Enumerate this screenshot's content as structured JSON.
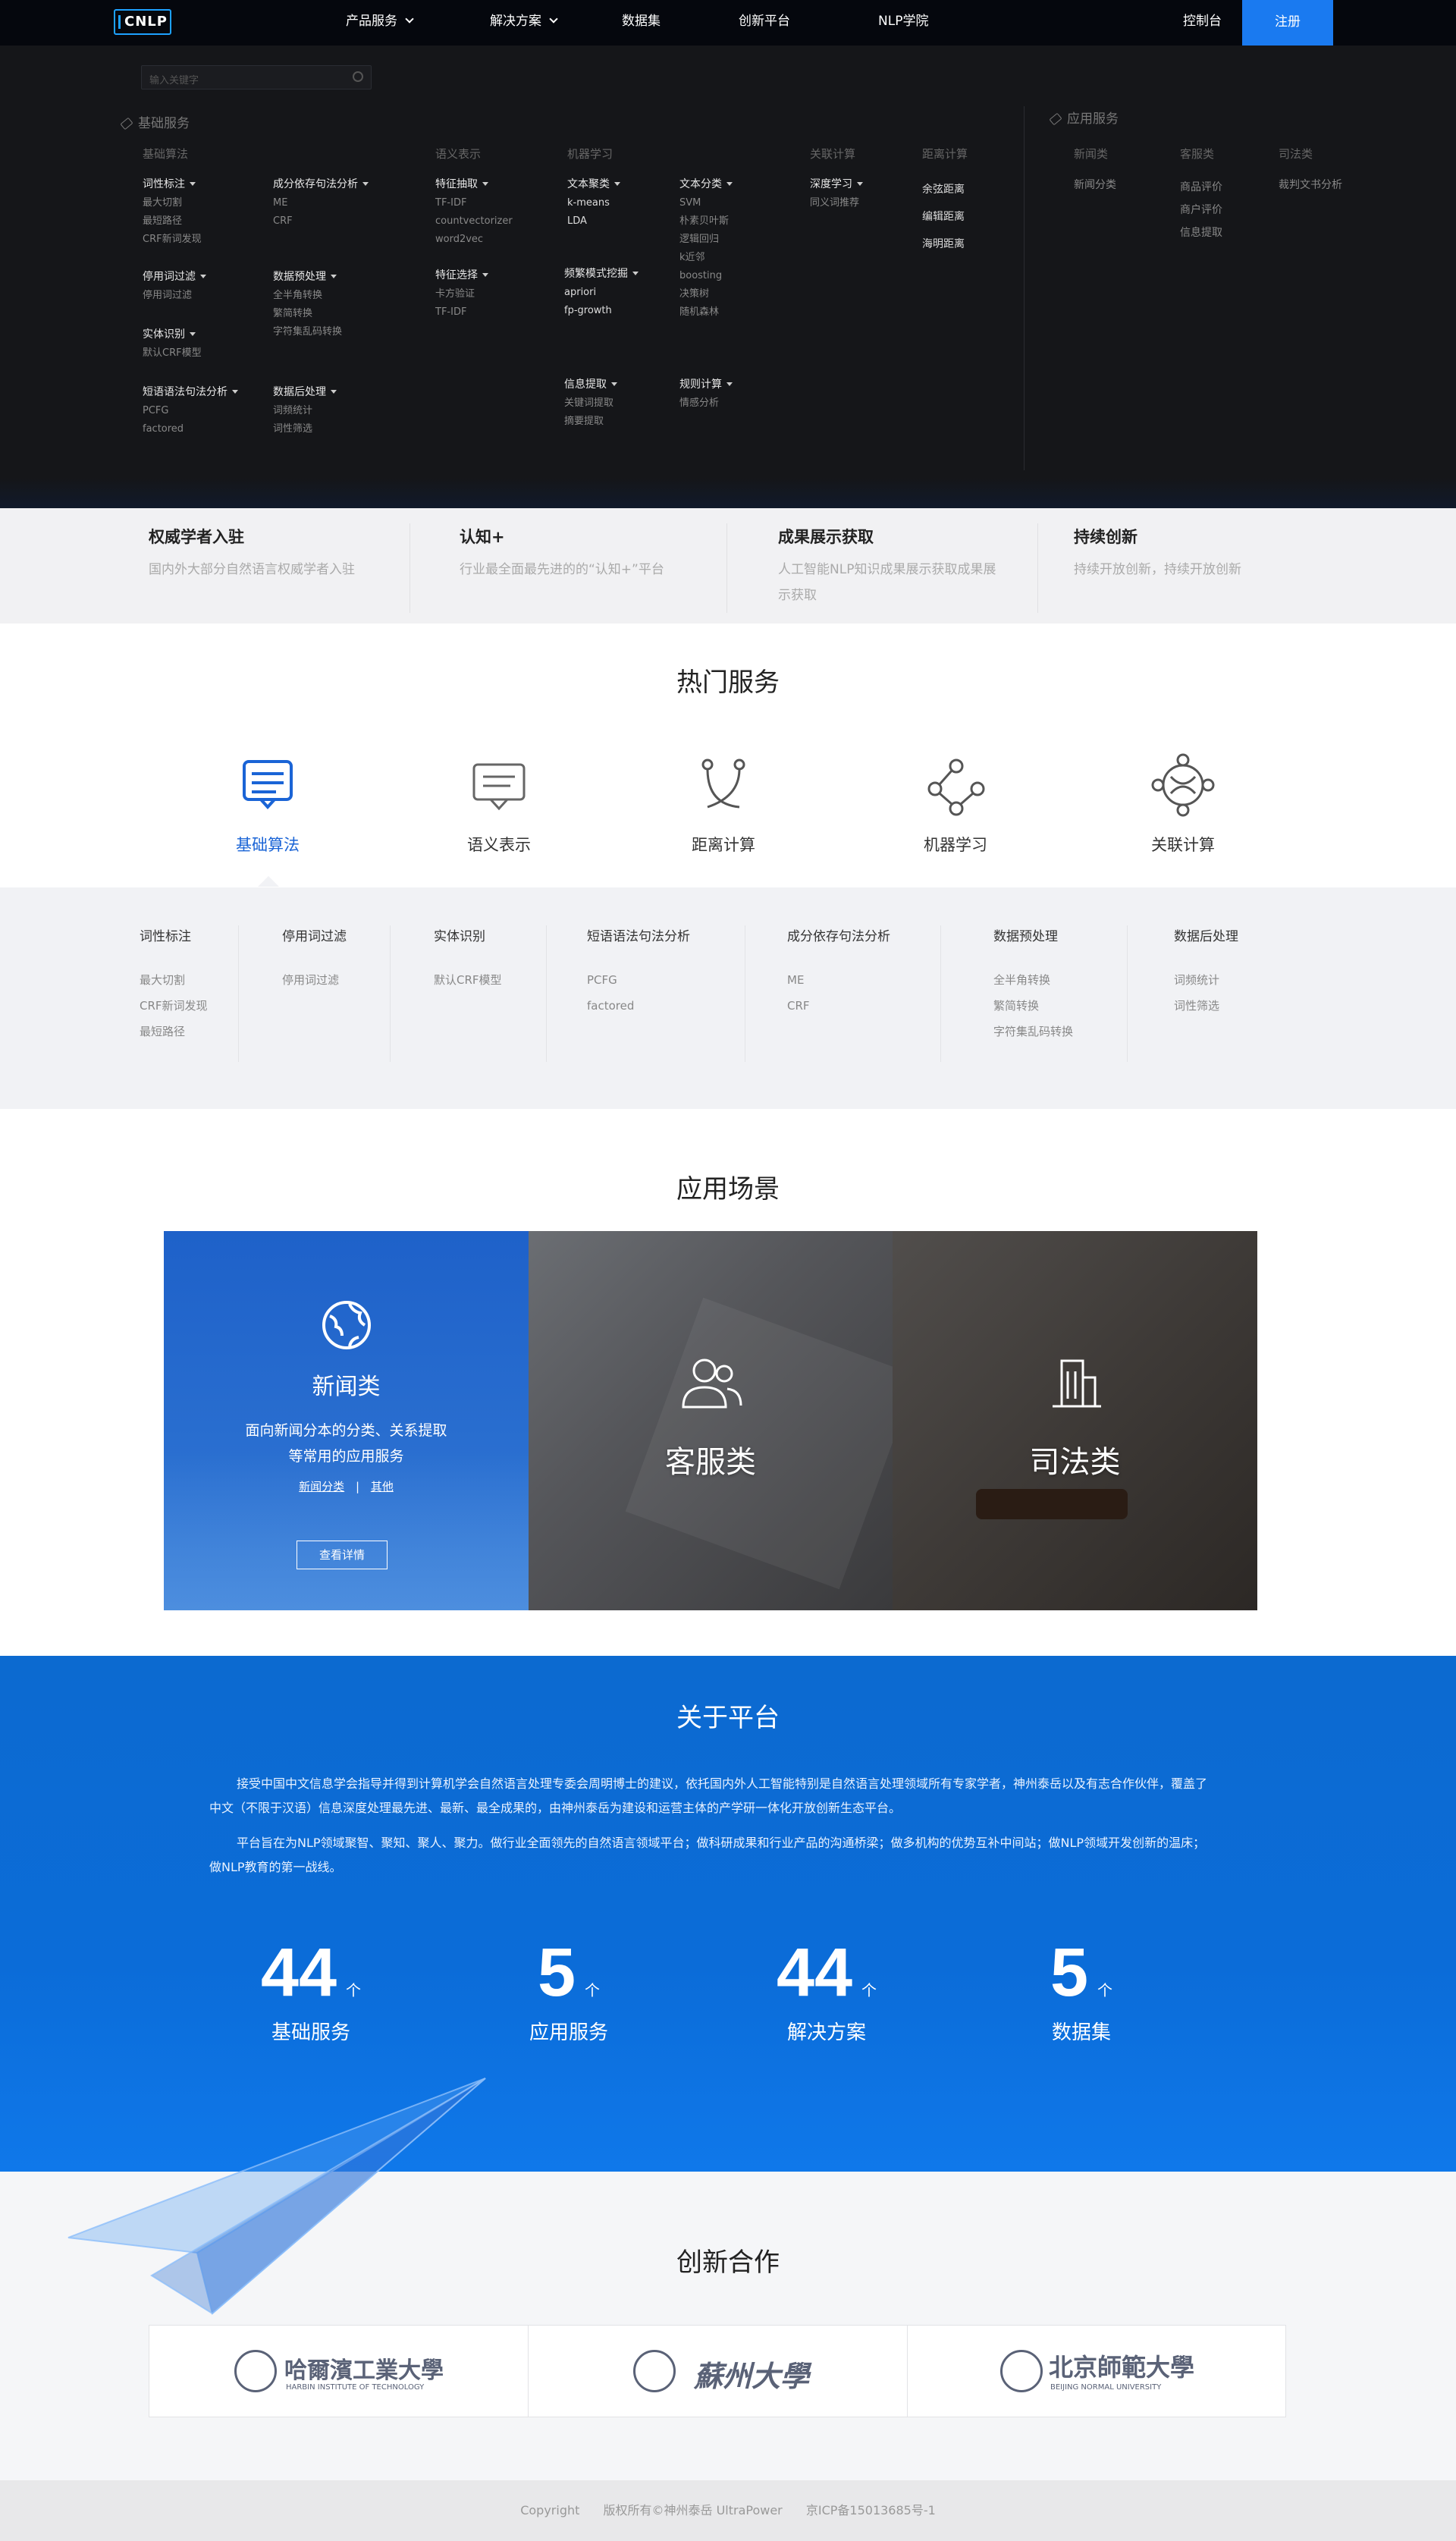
{
  "nav": {
    "logo": "CNLP",
    "items": [
      "产品服务",
      "解决方案",
      "数据集",
      "创新平台",
      "NLP学院"
    ],
    "console": "控制台",
    "register": "注册"
  },
  "mega": {
    "search_placeholder": "输入关键字",
    "basic_header": "基础服务",
    "app_header": "应用服务",
    "cats": {
      "basic_algo": "基础算法",
      "semantic": "语义表示",
      "ml": "机器学习",
      "assoc": "关联计算",
      "dist": "距离计算",
      "news": "新闻类",
      "cs": "客服类",
      "law": "司法类"
    },
    "groups": {
      "pos": {
        "title": "词性标注",
        "items": [
          "最大切割",
          "最短路径",
          "CRF新词发现"
        ]
      },
      "const": {
        "title": "成分依存句法分析",
        "items": [
          "ME",
          "CRF"
        ]
      },
      "stop": {
        "title": "停用词过滤",
        "items": [
          "停用词过滤"
        ]
      },
      "pre": {
        "title": "数据预处理",
        "items": [
          "全半角转换",
          "繁简转换",
          "字符集乱码转换"
        ]
      },
      "ner": {
        "title": "实体识别",
        "items": [
          "默认CRF模型"
        ]
      },
      "phrase": {
        "title": "短语语法句法分析",
        "items": [
          "PCFG",
          "factored"
        ]
      },
      "post": {
        "title": "数据后处理",
        "items": [
          "词频统计",
          "词性筛选"
        ]
      },
      "feat": {
        "title": "特征抽取",
        "items": [
          "TF-IDF",
          "countvectorizer",
          "word2vec"
        ]
      },
      "fsel": {
        "title": "特征选择",
        "items": [
          "卡方验证",
          "TF-IDF"
        ]
      },
      "tclu": {
        "title": "文本聚类",
        "items": [
          "k-means",
          "LDA"
        ]
      },
      "freq": {
        "title": "频繁模式挖掘",
        "items": [
          "apriori",
          "fp-growth"
        ]
      },
      "info": {
        "title": "信息提取",
        "items": [
          "关键词提取",
          "摘要提取"
        ]
      },
      "tcls": {
        "title": "文本分类",
        "items": [
          "SVM",
          "朴素贝叶斯",
          "逻辑回归",
          "k近邻",
          "boosting",
          "决策树",
          "随机森林"
        ]
      },
      "rule": {
        "title": "规则计算",
        "items": [
          "情感分析"
        ]
      },
      "deep": {
        "title": "深度学习",
        "items": [
          "同义词推荐"
        ]
      },
      "dist": {
        "items": [
          "余弦距离",
          "编辑距离",
          "海明距离"
        ]
      },
      "news": {
        "items": [
          "新闻分类"
        ]
      },
      "cs": {
        "items": [
          "商品评价",
          "商户评价",
          "信息提取"
        ]
      },
      "law": {
        "items": [
          "裁判文书分析"
        ]
      }
    }
  },
  "advantages": [
    {
      "title": "权威学者入驻",
      "desc": "国内外大部分自然语言权威学者入驻"
    },
    {
      "title": "认知+",
      "desc": "行业最全面最先进的的“认知+”平台"
    },
    {
      "title": "成果展示获取",
      "desc": "人工智能NLP知识成果展示获取成果展示获取"
    },
    {
      "title": "持续创新",
      "desc": "持续开放创新，持续开放创新"
    }
  ],
  "hot": {
    "title": "热门服务",
    "services": [
      "基础算法",
      "语义表示",
      "距离计算",
      "机器学习",
      "关联计算"
    ],
    "columns": [
      {
        "title": "词性标注",
        "items": [
          "最大切割",
          "CRF新词发现",
          "最短路径"
        ]
      },
      {
        "title": "停用词过滤",
        "items": [
          "停用词过滤"
        ]
      },
      {
        "title": "实体识别",
        "items": [
          "默认CRF模型"
        ]
      },
      {
        "title": "短语语法句法分析",
        "items": [
          "PCFG",
          "factored"
        ]
      },
      {
        "title": "成分依存句法分析",
        "items": [
          "ME",
          "CRF"
        ]
      },
      {
        "title": "数据预处理",
        "items": [
          "全半角转换",
          "繁简转换",
          "字符集乱码转换"
        ]
      },
      {
        "title": "数据后处理",
        "items": [
          "词频统计",
          "词性筛选"
        ]
      }
    ]
  },
  "scenes": {
    "title": "应用场景",
    "news": {
      "label": "新闻类",
      "desc1": "面向新闻分本的分类、关系提取",
      "desc2": "等常用的应用服务",
      "link1": "新闻分类",
      "sep": "|",
      "link2": "其他",
      "btn": "查看详情"
    },
    "cs": {
      "label": "客服类"
    },
    "law": {
      "label": "司法类"
    }
  },
  "about": {
    "title": "关于平台",
    "p1": "接受中国中文信息学会指导并得到计算机学会自然语言处理专委会周明博士的建议，依托国内外人工智能特别是自然语言处理领域所有专家学者，神州泰岳以及有志合作伙伴，覆盖了中文（不限于汉语）信息深度处理最先进、最新、最全成果的，由神州泰岳为建设和运营主体的产学研一体化开放创新生态平台。",
    "p2": "平台旨在为NLP领域聚智、聚知、聚人、聚力。做行业全面领先的自然语言领域平台；做科研成果和行业产品的沟通桥梁；做多机构的优势互补中间站；做NLP领域开发创新的温床；做NLP教育的第一战线。",
    "stats": [
      {
        "num": "44",
        "unit": "个",
        "label": "基础服务"
      },
      {
        "num": "5",
        "unit": "个",
        "label": "应用服务"
      },
      {
        "num": "44",
        "unit": "个",
        "label": "解决方案"
      },
      {
        "num": "5",
        "unit": "个",
        "label": "数据集"
      }
    ]
  },
  "coop": {
    "title": "创新合作",
    "partners": [
      {
        "cn": "哈爾濱工業大學",
        "en": "HARBIN INSTITUTE OF TECHNOLOGY"
      },
      {
        "cn": "蘇州大學",
        "en": ""
      },
      {
        "cn": "北京師範大學",
        "en": "BEIJING NORMAL UNIVERSITY"
      }
    ]
  },
  "footer": {
    "copyright": "Copyright",
    "rights": "版权所有©神州泰岳 UltraPower",
    "icp": "京ICP备15013685号-1"
  },
  "colors": {
    "accent": "#1a7af0",
    "active": "#1a64d6",
    "dark": "#151619",
    "about": "#0b6cd8"
  }
}
